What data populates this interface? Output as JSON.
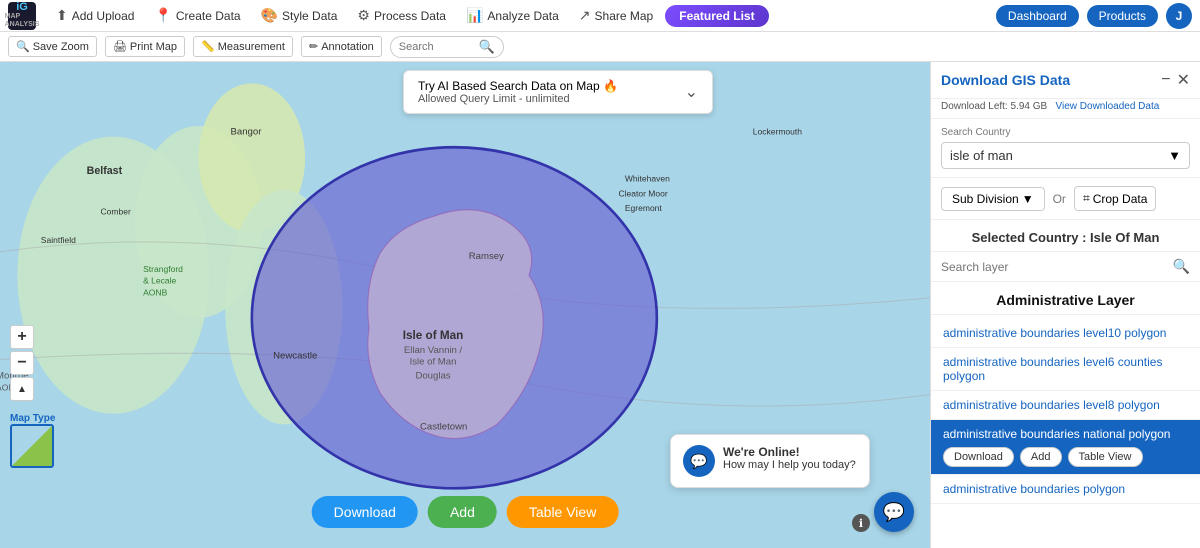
{
  "navbar": {
    "logo_line1": "iG",
    "logo_line2": "MAP\nANALYSIS",
    "items": [
      {
        "id": "add-upload",
        "label": "Add Upload",
        "icon": "⬆"
      },
      {
        "id": "create-data",
        "label": "Create Data",
        "icon": "📍"
      },
      {
        "id": "style-data",
        "label": "Style Data",
        "icon": "🎨"
      },
      {
        "id": "process-data",
        "label": "Process Data",
        "icon": "⚙"
      },
      {
        "id": "analyze-data",
        "label": "Analyze Data",
        "icon": "📊"
      },
      {
        "id": "share-map",
        "label": "Share Map",
        "icon": "↗"
      }
    ],
    "featured_label": "Featured List",
    "dashboard_label": "Dashboard",
    "products_label": "Products",
    "user_initial": "J"
  },
  "subtoolbar": {
    "save_zoom_label": "Save Zoom",
    "print_map_label": "Print Map",
    "measurement_label": "Measurement",
    "annotation_label": "Annotation",
    "search_placeholder": "Search"
  },
  "ai_banner": {
    "line1": "Try AI Based Search Data on Map 🔥",
    "line2": "Allowed Query Limit - unlimited"
  },
  "map": {
    "bottom_buttons": {
      "download_label": "Download",
      "add_label": "Add",
      "table_view_label": "Table View"
    },
    "type_label": "Map Type"
  },
  "right_panel": {
    "title": "Download GIS Data",
    "download_left": "Download Left: 5.94 GB",
    "view_downloaded": "View Downloaded Data",
    "search_country_label": "Search Country",
    "country_value": "isle of man",
    "sub_division_label": "Sub Division",
    "or_label": "Or",
    "crop_data_label": "Crop Data",
    "selected_country_label": "Selected Country : Isle Of Man",
    "search_layer_placeholder": "Search layer",
    "admin_layer_title": "Administrative Layer",
    "layers": [
      {
        "id": "l1",
        "label": "administrative boundaries level10 polygon",
        "active": false
      },
      {
        "id": "l2",
        "label": "administrative boundaries level6 counties polygon",
        "active": false
      },
      {
        "id": "l3",
        "label": "administrative boundaries level8 polygon",
        "active": false
      },
      {
        "id": "l4",
        "label": "administrative boundaries national polygon",
        "active": true
      },
      {
        "id": "l5",
        "label": "administrative boundaries polygon",
        "active": false
      }
    ],
    "layer_buttons": {
      "download_label": "Download",
      "add_label": "Add",
      "table_view_label": "Table View"
    }
  },
  "chat": {
    "title": "We're Online!",
    "subtitle": "How may I help you today?"
  },
  "colors": {
    "primary": "#1565c0",
    "featured": "#7c4dff",
    "map_overlay": "rgba(100, 90, 210, 0.6)",
    "active_layer_bg": "#1565c0"
  }
}
